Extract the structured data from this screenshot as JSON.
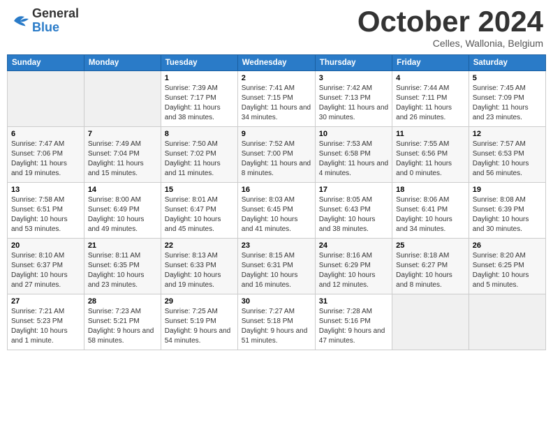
{
  "header": {
    "logo_general": "General",
    "logo_blue": "Blue",
    "month_title": "October 2024",
    "subtitle": "Celles, Wallonia, Belgium"
  },
  "days_of_week": [
    "Sunday",
    "Monday",
    "Tuesday",
    "Wednesday",
    "Thursday",
    "Friday",
    "Saturday"
  ],
  "weeks": [
    [
      {
        "day": "",
        "sunrise": "",
        "sunset": "",
        "daylight": ""
      },
      {
        "day": "",
        "sunrise": "",
        "sunset": "",
        "daylight": ""
      },
      {
        "day": "1",
        "sunrise": "Sunrise: 7:39 AM",
        "sunset": "Sunset: 7:17 PM",
        "daylight": "Daylight: 11 hours and 38 minutes."
      },
      {
        "day": "2",
        "sunrise": "Sunrise: 7:41 AM",
        "sunset": "Sunset: 7:15 PM",
        "daylight": "Daylight: 11 hours and 34 minutes."
      },
      {
        "day": "3",
        "sunrise": "Sunrise: 7:42 AM",
        "sunset": "Sunset: 7:13 PM",
        "daylight": "Daylight: 11 hours and 30 minutes."
      },
      {
        "day": "4",
        "sunrise": "Sunrise: 7:44 AM",
        "sunset": "Sunset: 7:11 PM",
        "daylight": "Daylight: 11 hours and 26 minutes."
      },
      {
        "day": "5",
        "sunrise": "Sunrise: 7:45 AM",
        "sunset": "Sunset: 7:09 PM",
        "daylight": "Daylight: 11 hours and 23 minutes."
      }
    ],
    [
      {
        "day": "6",
        "sunrise": "Sunrise: 7:47 AM",
        "sunset": "Sunset: 7:06 PM",
        "daylight": "Daylight: 11 hours and 19 minutes."
      },
      {
        "day": "7",
        "sunrise": "Sunrise: 7:49 AM",
        "sunset": "Sunset: 7:04 PM",
        "daylight": "Daylight: 11 hours and 15 minutes."
      },
      {
        "day": "8",
        "sunrise": "Sunrise: 7:50 AM",
        "sunset": "Sunset: 7:02 PM",
        "daylight": "Daylight: 11 hours and 11 minutes."
      },
      {
        "day": "9",
        "sunrise": "Sunrise: 7:52 AM",
        "sunset": "Sunset: 7:00 PM",
        "daylight": "Daylight: 11 hours and 8 minutes."
      },
      {
        "day": "10",
        "sunrise": "Sunrise: 7:53 AM",
        "sunset": "Sunset: 6:58 PM",
        "daylight": "Daylight: 11 hours and 4 minutes."
      },
      {
        "day": "11",
        "sunrise": "Sunrise: 7:55 AM",
        "sunset": "Sunset: 6:56 PM",
        "daylight": "Daylight: 11 hours and 0 minutes."
      },
      {
        "day": "12",
        "sunrise": "Sunrise: 7:57 AM",
        "sunset": "Sunset: 6:53 PM",
        "daylight": "Daylight: 10 hours and 56 minutes."
      }
    ],
    [
      {
        "day": "13",
        "sunrise": "Sunrise: 7:58 AM",
        "sunset": "Sunset: 6:51 PM",
        "daylight": "Daylight: 10 hours and 53 minutes."
      },
      {
        "day": "14",
        "sunrise": "Sunrise: 8:00 AM",
        "sunset": "Sunset: 6:49 PM",
        "daylight": "Daylight: 10 hours and 49 minutes."
      },
      {
        "day": "15",
        "sunrise": "Sunrise: 8:01 AM",
        "sunset": "Sunset: 6:47 PM",
        "daylight": "Daylight: 10 hours and 45 minutes."
      },
      {
        "day": "16",
        "sunrise": "Sunrise: 8:03 AM",
        "sunset": "Sunset: 6:45 PM",
        "daylight": "Daylight: 10 hours and 41 minutes."
      },
      {
        "day": "17",
        "sunrise": "Sunrise: 8:05 AM",
        "sunset": "Sunset: 6:43 PM",
        "daylight": "Daylight: 10 hours and 38 minutes."
      },
      {
        "day": "18",
        "sunrise": "Sunrise: 8:06 AM",
        "sunset": "Sunset: 6:41 PM",
        "daylight": "Daylight: 10 hours and 34 minutes."
      },
      {
        "day": "19",
        "sunrise": "Sunrise: 8:08 AM",
        "sunset": "Sunset: 6:39 PM",
        "daylight": "Daylight: 10 hours and 30 minutes."
      }
    ],
    [
      {
        "day": "20",
        "sunrise": "Sunrise: 8:10 AM",
        "sunset": "Sunset: 6:37 PM",
        "daylight": "Daylight: 10 hours and 27 minutes."
      },
      {
        "day": "21",
        "sunrise": "Sunrise: 8:11 AM",
        "sunset": "Sunset: 6:35 PM",
        "daylight": "Daylight: 10 hours and 23 minutes."
      },
      {
        "day": "22",
        "sunrise": "Sunrise: 8:13 AM",
        "sunset": "Sunset: 6:33 PM",
        "daylight": "Daylight: 10 hours and 19 minutes."
      },
      {
        "day": "23",
        "sunrise": "Sunrise: 8:15 AM",
        "sunset": "Sunset: 6:31 PM",
        "daylight": "Daylight: 10 hours and 16 minutes."
      },
      {
        "day": "24",
        "sunrise": "Sunrise: 8:16 AM",
        "sunset": "Sunset: 6:29 PM",
        "daylight": "Daylight: 10 hours and 12 minutes."
      },
      {
        "day": "25",
        "sunrise": "Sunrise: 8:18 AM",
        "sunset": "Sunset: 6:27 PM",
        "daylight": "Daylight: 10 hours and 8 minutes."
      },
      {
        "day": "26",
        "sunrise": "Sunrise: 8:20 AM",
        "sunset": "Sunset: 6:25 PM",
        "daylight": "Daylight: 10 hours and 5 minutes."
      }
    ],
    [
      {
        "day": "27",
        "sunrise": "Sunrise: 7:21 AM",
        "sunset": "Sunset: 5:23 PM",
        "daylight": "Daylight: 10 hours and 1 minute."
      },
      {
        "day": "28",
        "sunrise": "Sunrise: 7:23 AM",
        "sunset": "Sunset: 5:21 PM",
        "daylight": "Daylight: 9 hours and 58 minutes."
      },
      {
        "day": "29",
        "sunrise": "Sunrise: 7:25 AM",
        "sunset": "Sunset: 5:19 PM",
        "daylight": "Daylight: 9 hours and 54 minutes."
      },
      {
        "day": "30",
        "sunrise": "Sunrise: 7:27 AM",
        "sunset": "Sunset: 5:18 PM",
        "daylight": "Daylight: 9 hours and 51 minutes."
      },
      {
        "day": "31",
        "sunrise": "Sunrise: 7:28 AM",
        "sunset": "Sunset: 5:16 PM",
        "daylight": "Daylight: 9 hours and 47 minutes."
      },
      {
        "day": "",
        "sunrise": "",
        "sunset": "",
        "daylight": ""
      },
      {
        "day": "",
        "sunrise": "",
        "sunset": "",
        "daylight": ""
      }
    ]
  ]
}
